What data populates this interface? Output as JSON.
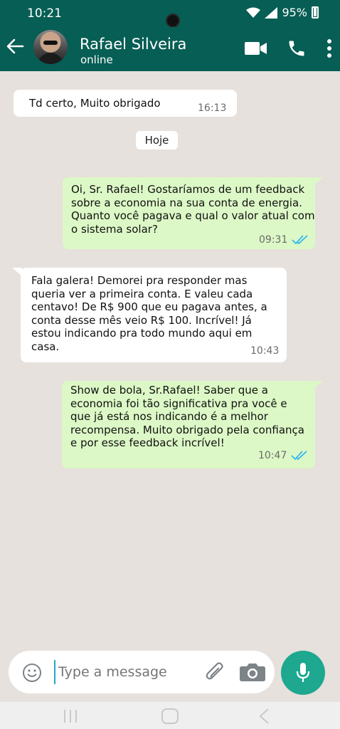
{
  "status_bar": {
    "time": "10:21",
    "battery": "95%"
  },
  "header": {
    "contact_name": "Rafael Silveira",
    "contact_status": "online",
    "icons": [
      "back-arrow-icon",
      "video-call-icon",
      "phone-icon",
      "more-vert-icon"
    ]
  },
  "messages": [
    {
      "direction": "incoming",
      "text": "Td certo, Muito obrigado",
      "time": "16:13"
    },
    {
      "direction": "outgoing",
      "lines": [
        "Oi, Sr. Rafael! Gostaríamos de um feedback",
        "sobre a economia na sua conta de energia.",
        "Quanto você pagava e qual o valor atual com",
        "o sistema solar?"
      ],
      "time": "09:31",
      "read": true
    },
    {
      "direction": "incoming",
      "lines": [
        "Fala galera! Demorei pra responder mas",
        "queria ver a primeira conta. E valeu cada",
        "centavo! De R$ 900 que eu pagava antes, a",
        "conta desse mês veio R$ 100. Incrível! Já",
        "estou indicando pra todo mundo aqui em",
        "casa."
      ],
      "time": "10:43"
    },
    {
      "direction": "outgoing",
      "lines": [
        "Show de bola, Sr.Rafael! Saber que a",
        "economia foi tão significativa pra você e",
        "que já está nos indicando é a melhor",
        "recompensa. Muito obrigado pela confiança",
        "e por esse feedback incrível!"
      ],
      "time": "10:47",
      "read": true
    }
  ],
  "date_separator": "Hoje",
  "composer": {
    "placeholder": "Type a message"
  },
  "colors": {
    "header": "#075e54",
    "outgoing_bubble": "#dcf8c6",
    "incoming_bubble": "#ffffff",
    "chat_bg": "#e6e1dc",
    "mic": "#1da88f",
    "read_ticks": "#34b7f1"
  }
}
